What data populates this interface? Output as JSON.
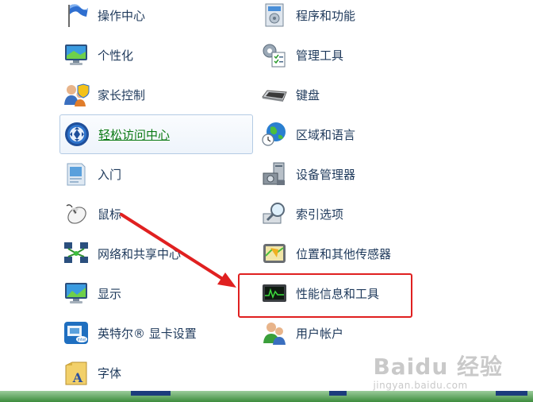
{
  "left_items": [
    {
      "label": "操作中心",
      "icon": "flag-icon"
    },
    {
      "label": "个性化",
      "icon": "personalization-icon"
    },
    {
      "label": "家长控制",
      "icon": "parental-controls-icon"
    },
    {
      "label": "轻松访问中心",
      "icon": "ease-of-access-icon"
    },
    {
      "label": "入门",
      "icon": "getting-started-icon"
    },
    {
      "label": "鼠标",
      "icon": "mouse-icon"
    },
    {
      "label": "网络和共享中心",
      "icon": "network-icon"
    },
    {
      "label": "显示",
      "icon": "display-icon"
    },
    {
      "label": "英特尔® 显卡设置",
      "icon": "intel-graphics-icon"
    },
    {
      "label": "字体",
      "icon": "fonts-icon"
    }
  ],
  "right_items": [
    {
      "label": "程序和功能",
      "icon": "programs-icon"
    },
    {
      "label": "管理工具",
      "icon": "admin-tools-icon"
    },
    {
      "label": "键盘",
      "icon": "keyboard-icon"
    },
    {
      "label": "区域和语言",
      "icon": "globe-icon"
    },
    {
      "label": "设备管理器",
      "icon": "device-manager-icon"
    },
    {
      "label": "索引选项",
      "icon": "indexing-icon"
    },
    {
      "label": "位置和其他传感器",
      "icon": "location-sensor-icon"
    },
    {
      "label": "性能信息和工具",
      "icon": "performance-icon"
    },
    {
      "label": "用户帐户",
      "icon": "user-accounts-icon"
    }
  ],
  "hovered_item": "轻松访问中心",
  "highlighted_item": "性能信息和工具",
  "colors": {
    "link_text": "#1e395b",
    "hover_text": "#0b7a13",
    "highlight_box": "#e02020",
    "arrow": "#e02020"
  },
  "watermark": {
    "main": "Baidu 经验",
    "sub": "jingyan.baidu.com"
  }
}
